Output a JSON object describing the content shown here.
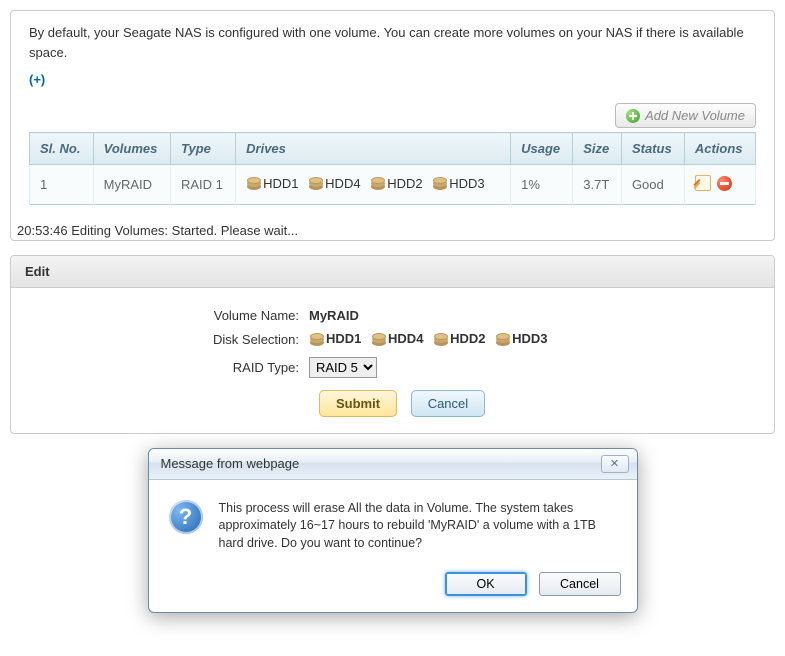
{
  "intro": "By default, your Seagate NAS is configured with one volume. You can create more volumes on your NAS if there is available space.",
  "help_link": "(+)",
  "add_button": "Add New Volume",
  "table": {
    "headers": {
      "slno": "Sl. No.",
      "volumes": "Volumes",
      "type": "Type",
      "drives": "Drives",
      "usage": "Usage",
      "size": "Size",
      "status": "Status",
      "actions": "Actions"
    },
    "row": {
      "slno": "1",
      "volume": "MyRAID",
      "type": "RAID 1",
      "drives": [
        "HDD1",
        "HDD4",
        "HDD2",
        "HDD3"
      ],
      "usage": "1%",
      "size": "3.7T",
      "status": "Good"
    }
  },
  "status_line": "20:53:46 Editing Volumes: Started. Please wait...",
  "edit": {
    "title": "Edit",
    "labels": {
      "volname": "Volume Name:",
      "disksel": "Disk Selection:",
      "raidtype": "RAID Type:"
    },
    "volume_name": "MyRAID",
    "disks": [
      "HDD1",
      "HDD4",
      "HDD2",
      "HDD3"
    ],
    "raid_selected": "RAID 5",
    "submit": "Submit",
    "cancel": "Cancel"
  },
  "dialog": {
    "title": "Message from webpage",
    "message": "This process will erase All the data in Volume. The system takes approximately 16~17 hours to rebuild  'MyRAID' a volume with a 1TB hard drive. Do you want to continue?",
    "ok": "OK",
    "cancel": "Cancel"
  }
}
